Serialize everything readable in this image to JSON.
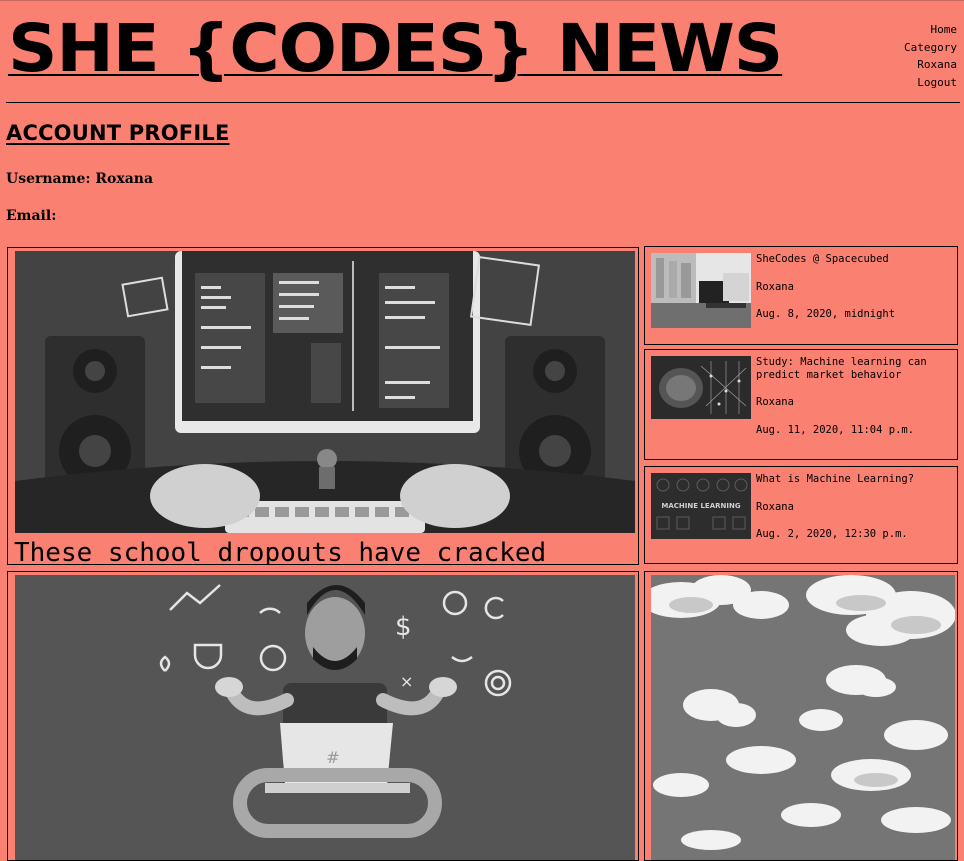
{
  "header": {
    "site_title": "SHE {CODES} NEWS",
    "nav": [
      "Home",
      "Category",
      "Roxana",
      "Logout"
    ]
  },
  "profile": {
    "heading": "ACCOUNT PROFILE",
    "username_label": "Username: Roxana",
    "email_label": "Email:"
  },
  "main_stories": [
    {
      "title": "These school dropouts have cracked"
    },
    {
      "title": ""
    }
  ],
  "side_stories": [
    {
      "title": "SheCodes @ Spacecubed",
      "author": "Roxana",
      "date": "Aug. 8, 2020, midnight"
    },
    {
      "title": "Study: Machine learning can predict market behavior",
      "author": "Roxana",
      "date": "Aug. 11, 2020, 11:04 p.m."
    },
    {
      "title": "What is Machine Learning?",
      "author": "Roxana",
      "date": "Aug. 2, 2020, 12:30 p.m."
    }
  ],
  "thumb_labels": {
    "ml": "MACHINE LEARNING"
  }
}
